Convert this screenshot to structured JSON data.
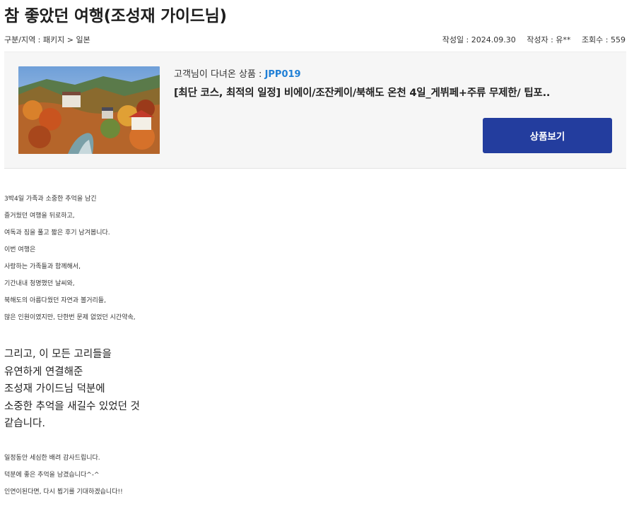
{
  "post": {
    "title": "참 좋았던 여행(조성재 가이드님)",
    "breadcrumb": "구분/지역 : 패키지 > 일본",
    "date": "작성일 : 2024.09.30",
    "author": "작성자 : 유**",
    "views": "조회수 : 559"
  },
  "product": {
    "label_prefix": "고객님이 다녀온 상품 : ",
    "code": "JPP019",
    "name": "[최단 코스, 최적의 일정] 비에이/조잔케이/북해도 온천 4일_게뷔페+주류 무제한/ 팁포..",
    "button_label": "상품보기"
  },
  "content": {
    "paragraph1": [
      "3박4일 가족과 소중한 추억을 남긴",
      "즐거웠던 여행을 뒤로하고,",
      "여독과 짐을 풀고 짧은 후기 남겨봅니다.",
      "이번 여행은",
      "사랑하는 가족들과 함께해서,",
      "기간내내 청명했던 날씨와,",
      "북해도의 아름다웠던 자연과 볼거리들,",
      "많은 인원이였지만, 단한번 문제 없었던 시간약속,"
    ],
    "paragraph2": [
      "그리고, 이 모든 고리들을",
      "유연하게 연결해준",
      "조성재 가이드님 덕분에",
      "소중한 추억을 새길수 있었던 것",
      "같습니다."
    ],
    "paragraph3": [
      "일정동안 세심한 배려 감사드립니다.",
      "덕분에 좋은 추억을 남겼습니다^-^",
      "인연이된다면, 다시 뵙기를 기대하겠습니다!!"
    ]
  },
  "colors": {
    "button_bg": "#233d9e",
    "code_color": "#1f7fd6",
    "box_bg": "#f6f6f6"
  }
}
